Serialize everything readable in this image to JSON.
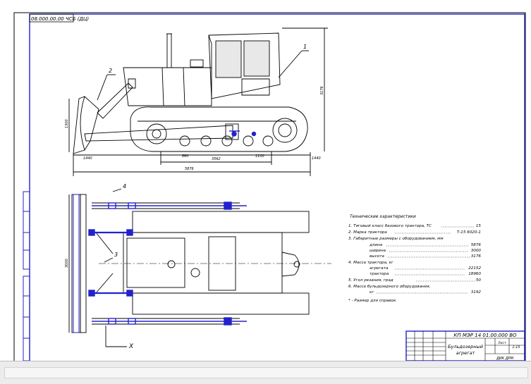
{
  "sheet": {
    "corner_code": "08.000.00.00 ЧСБ (ДЦ)",
    "callouts": [
      "1",
      "2",
      "4",
      "3"
    ],
    "dimensions": {
      "overall_length": "5876",
      "track_base": "3562",
      "height": "3176",
      "blade_height": "1300",
      "dim_a": "1440",
      "dim_b": "860",
      "dim_c": "1100",
      "dim_d": "1440",
      "plan_width": "3000"
    },
    "axis_label": "X"
  },
  "tech": {
    "title": "Технические характеристики",
    "lines": [
      {
        "text": "1. Тяговый класс базового трактора, ТС",
        "value": "15"
      },
      {
        "text": "2. Марка трактора",
        "value": "Т-15 6020-1"
      },
      {
        "text": "3. Габаритные размеры с оборудованием, мм",
        "value": ""
      },
      {
        "text": "длина",
        "value": "5876"
      },
      {
        "text": "ширина",
        "value": "3000"
      },
      {
        "text": "высота",
        "value": "3176"
      },
      {
        "text": "4. Масса трактора, кг",
        "value": ""
      },
      {
        "text": "агрегата",
        "value": "22152"
      },
      {
        "text": "трактора",
        "value": "18960"
      },
      {
        "text": "5. Угол резания, град",
        "value": "50"
      },
      {
        "text": "6. Масса бульдозерного оборудования,",
        "value": ""
      },
      {
        "text": "кг",
        "value": "3192"
      }
    ],
    "footnote": "* - Размер для справок"
  },
  "title_block": {
    "designation": "КП МЭР 14 01.00.000 ВО",
    "name_line1": "Бульдозерный",
    "name_line2": "агрегат",
    "org": "ДИК ДРМ",
    "scale": "1:15",
    "sheet": "Лист"
  }
}
